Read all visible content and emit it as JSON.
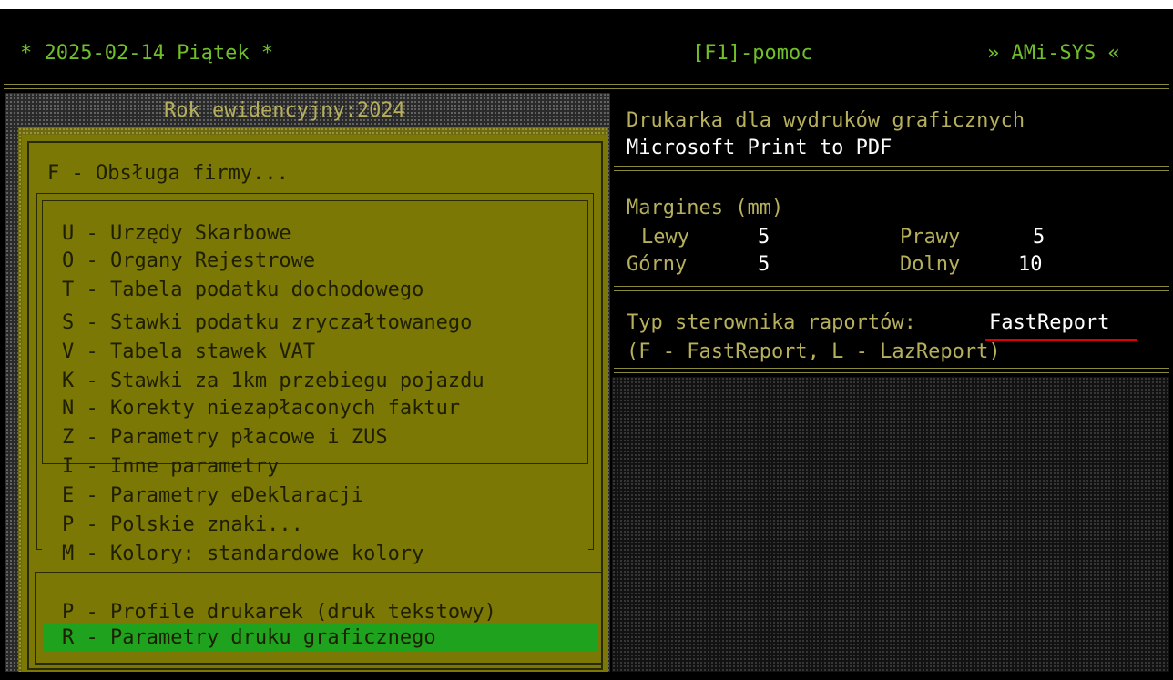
{
  "header": {
    "date": "* 2025-02-14 Piątek *",
    "help": "[F1]-pomoc",
    "app": "» AMi-SYS «"
  },
  "year_label": "Rok ewidencyjny:2024",
  "menu": {
    "title": "F - Obsługa firmy...",
    "items": [
      "U - Urzędy Skarbowe",
      "O - Organy Rejestrowe",
      "T - Tabela podatku dochodowego",
      "S - Stawki podatku zryczałtowanego",
      "V - Tabela stawek VAT",
      "K - Stawki za 1km przebiegu pojazdu",
      "N - Korekty niezapłaconych faktur",
      "Z - Parametry płacowe i ZUS",
      "I - Inne parametry",
      "E - Parametry eDeklaracji",
      "P - Polskie znaki...",
      "M - Kolory: standardowe kolory"
    ],
    "bottom_items": [
      "P - Profile drukarek (druk tekstowy)",
      "R - Parametry druku graficznego"
    ]
  },
  "printer": {
    "label": "Drukarka dla wydruków graficznych",
    "value": "Microsoft Print to PDF"
  },
  "margins": {
    "title": "Margines (mm)",
    "left_label": "Lewy",
    "left_value": "5",
    "right_label": "Prawy",
    "right_value": "5",
    "top_label": "Górny",
    "top_value": "5",
    "bottom_label": "Dolny",
    "bottom_value": "10"
  },
  "report": {
    "label": "Typ sterownika raportów:",
    "value": "FastReport",
    "hint": "(F - FastReport, L - LazReport)"
  }
}
